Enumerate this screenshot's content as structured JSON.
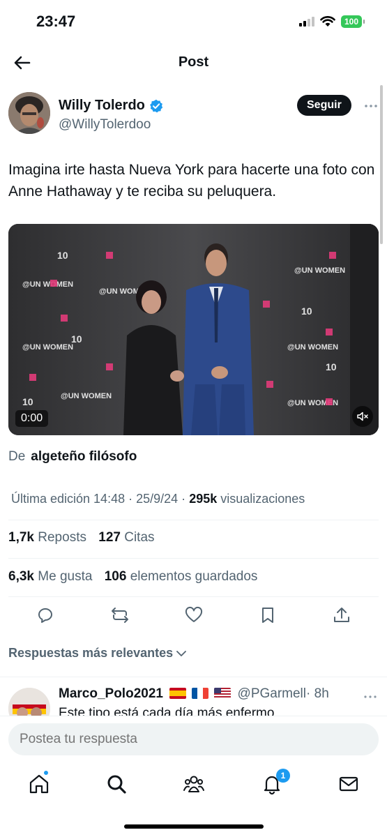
{
  "status_bar": {
    "time": "23:47",
    "battery": "100"
  },
  "header": {
    "title": "Post"
  },
  "author": {
    "name": "Willy Tolerdo",
    "handle": "@WillyTolerdoo",
    "follow_label": "Seguir",
    "verified_color": "#1d9bf0"
  },
  "tweet": {
    "text": "Imagina irte hasta Nueva York para hacerte una foto con Anne Hathaway y te reciba su peluquera."
  },
  "media": {
    "type": "video",
    "time": "0:00",
    "backdrop_text": [
      "@UN WOMEN",
      "10"
    ]
  },
  "source": {
    "prefix": "De",
    "name": "algeteño filósofo"
  },
  "meta": {
    "edited": "Última edición 14:48 · 25/9/24",
    "separator": "·",
    "views_count": "295k",
    "views_label": "visualizaciones"
  },
  "stats": {
    "reposts_count": "1,7k",
    "reposts_label": "Reposts",
    "quotes_count": "127",
    "quotes_label": "Citas",
    "likes_count": "6,3k",
    "likes_label": "Me gusta",
    "bookmarks_count": "106",
    "bookmarks_label": "elementos guardados"
  },
  "actions": [
    "reply-icon",
    "repost-icon",
    "like-icon",
    "bookmark-icon",
    "share-icon"
  ],
  "replies_filter": {
    "label": "Respuestas más relevantes"
  },
  "reply": {
    "name": "Marco_Polo2021",
    "flags": [
      "spain",
      "france",
      "usa"
    ],
    "handle": "@PGarmell",
    "time": "· 8h",
    "text": "Este tipo está cada día más enfermo"
  },
  "compose": {
    "placeholder": "Postea tu respuesta"
  },
  "tabbar": {
    "items": [
      "home-icon",
      "search-icon",
      "communities-icon",
      "notifications-icon",
      "messages-icon"
    ],
    "notifications_badge": "1"
  },
  "colors": {
    "accent": "#1d9bf0",
    "text": "#0f1419",
    "muted": "#536471"
  }
}
